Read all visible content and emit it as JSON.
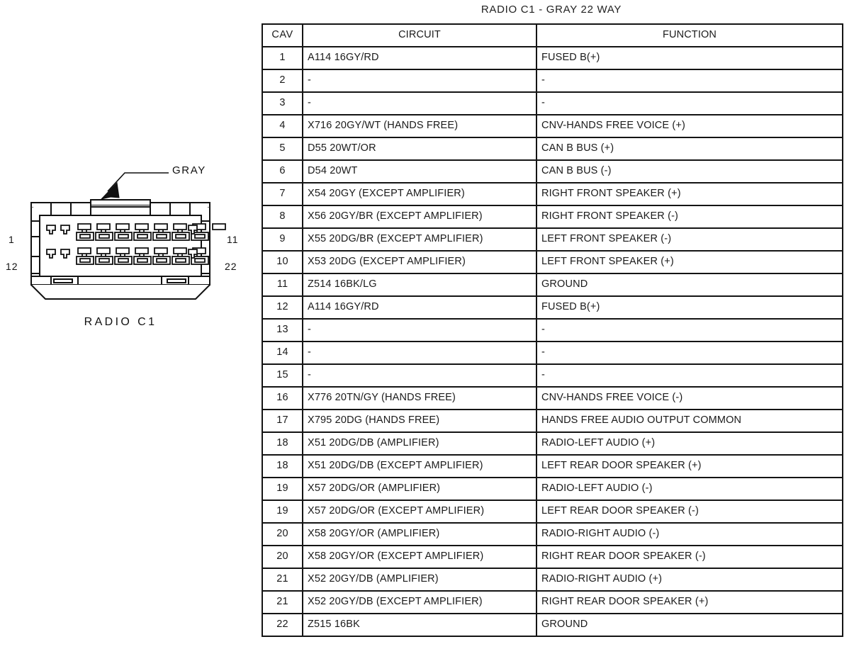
{
  "diagram": {
    "title": "RADIO C1 - GRAY 22 WAY",
    "connector_color_label": "GRAY",
    "connector_caption": "RADIO C1",
    "pin_markers": {
      "top_left": "1",
      "bottom_left": "12",
      "top_right": "11",
      "bottom_right": "22"
    },
    "cavity_count": 22,
    "rows_of_cavities": 2,
    "cavities_per_row": 11
  },
  "table": {
    "columns": [
      "CAV",
      "CIRCUIT",
      "FUNCTION"
    ],
    "rows": [
      {
        "cav": "1",
        "circuit": "A114 16GY/RD",
        "function": "FUSED B(+)"
      },
      {
        "cav": "2",
        "circuit": "-",
        "function": "-"
      },
      {
        "cav": "3",
        "circuit": "-",
        "function": "-"
      },
      {
        "cav": "4",
        "circuit": "X716 20GY/WT (HANDS FREE)",
        "function": "CNV-HANDS FREE VOICE (+)"
      },
      {
        "cav": "5",
        "circuit": "D55 20WT/OR",
        "function": "CAN B BUS (+)"
      },
      {
        "cav": "6",
        "circuit": "D54 20WT",
        "function": "CAN B BUS (-)"
      },
      {
        "cav": "7",
        "circuit": "X54 20GY (EXCEPT AMPLIFIER)",
        "function": "RIGHT FRONT SPEAKER (+)"
      },
      {
        "cav": "8",
        "circuit": "X56 20GY/BR (EXCEPT AMPLIFIER)",
        "function": "RIGHT FRONT SPEAKER (-)"
      },
      {
        "cav": "9",
        "circuit": "X55 20DG/BR (EXCEPT AMPLIFIER)",
        "function": "LEFT FRONT SPEAKER (-)"
      },
      {
        "cav": "10",
        "circuit": "X53 20DG (EXCEPT AMPLIFIER)",
        "function": "LEFT FRONT SPEAKER (+)"
      },
      {
        "cav": "11",
        "circuit": "Z514 16BK/LG",
        "function": "GROUND"
      },
      {
        "cav": "12",
        "circuit": "A114 16GY/RD",
        "function": "FUSED B(+)"
      },
      {
        "cav": "13",
        "circuit": "-",
        "function": "-"
      },
      {
        "cav": "14",
        "circuit": "-",
        "function": "-"
      },
      {
        "cav": "15",
        "circuit": "-",
        "function": "-"
      },
      {
        "cav": "16",
        "circuit": "X776 20TN/GY (HANDS FREE)",
        "function": "CNV-HANDS FREE VOICE (-)"
      },
      {
        "cav": "17",
        "circuit": "X795 20DG (HANDS FREE)",
        "function": "HANDS FREE AUDIO OUTPUT COMMON"
      },
      {
        "cav": "18",
        "circuit": "X51 20DG/DB (AMPLIFIER)",
        "function": "RADIO-LEFT AUDIO (+)"
      },
      {
        "cav": "18",
        "circuit": "X51 20DG/DB (EXCEPT AMPLIFIER)",
        "function": "LEFT REAR DOOR SPEAKER (+)"
      },
      {
        "cav": "19",
        "circuit": "X57 20DG/OR (AMPLIFIER)",
        "function": "RADIO-LEFT AUDIO (-)"
      },
      {
        "cav": "19",
        "circuit": "X57 20DG/OR (EXCEPT AMPLIFIER)",
        "function": "LEFT REAR DOOR SPEAKER (-)"
      },
      {
        "cav": "20",
        "circuit": "X58 20GY/OR (AMPLIFIER)",
        "function": "RADIO-RIGHT AUDIO (-)"
      },
      {
        "cav": "20",
        "circuit": "X58 20GY/OR (EXCEPT AMPLIFIER)",
        "function": "RIGHT REAR DOOR SPEAKER (-)"
      },
      {
        "cav": "21",
        "circuit": "X52 20GY/DB (AMPLIFIER)",
        "function": "RADIO-RIGHT AUDIO (+)"
      },
      {
        "cav": "21",
        "circuit": "X52 20GY/DB (EXCEPT AMPLIFIER)",
        "function": "RIGHT REAR DOOR SPEAKER (+)"
      },
      {
        "cav": "22",
        "circuit": "Z515 16BK",
        "function": "GROUND"
      }
    ]
  },
  "colors": {
    "line": "#141414",
    "text": "#1a1a1a",
    "background": "#ffffff"
  }
}
